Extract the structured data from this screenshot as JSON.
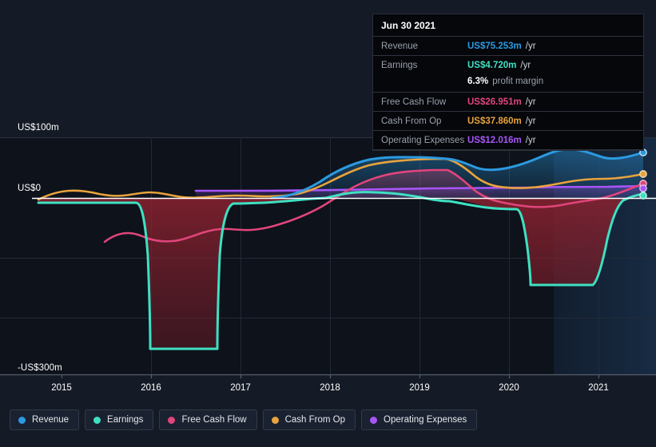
{
  "axes": {
    "y_labels": [
      {
        "text": "US$100m",
        "value": 100
      },
      {
        "text": "US$0",
        "value": 0
      },
      {
        "text": "-US$300m",
        "value": -300
      }
    ],
    "x_labels": [
      "2015",
      "2016",
      "2017",
      "2018",
      "2019",
      "2020",
      "2021"
    ]
  },
  "tooltip": {
    "date": "Jun 30 2021",
    "rows": [
      {
        "label": "Revenue",
        "value": "US$75.253m",
        "unit": "/yr",
        "color": "#2c9ae0"
      },
      {
        "label": "Earnings",
        "value": "US$4.720m",
        "unit": "/yr",
        "color": "#3fe0c2"
      },
      {
        "label": "",
        "value": "6.3%",
        "unit": "profit margin",
        "color": "#ffffff",
        "margin_row": true
      },
      {
        "label": "Free Cash Flow",
        "value": "US$26.951m",
        "unit": "/yr",
        "color": "#e0457b"
      },
      {
        "label": "Cash From Op",
        "value": "US$37.860m",
        "unit": "/yr",
        "color": "#e8a33d"
      },
      {
        "label": "Operating Expenses",
        "value": "US$12.016m",
        "unit": "/yr",
        "color": "#a855f7"
      }
    ]
  },
  "legend": {
    "items": [
      {
        "label": "Revenue",
        "color": "#2c9ae0"
      },
      {
        "label": "Earnings",
        "color": "#3fe0c2"
      },
      {
        "label": "Free Cash Flow",
        "color": "#e0457b"
      },
      {
        "label": "Cash From Op",
        "color": "#e8a33d"
      },
      {
        "label": "Operating Expenses",
        "color": "#a855f7"
      }
    ]
  },
  "chart_data": {
    "type": "area",
    "title": "",
    "xlabel": "",
    "ylabel": "US$",
    "ylim": [
      -300,
      100
    ],
    "xlim": [
      2014.75,
      2021.85
    ],
    "grid": true,
    "legend_position": "bottom-left",
    "annotations": [
      {
        "type": "forecast-region",
        "from_x": 2021.0,
        "label": ""
      }
    ],
    "x": [
      2014.75,
      2015.0,
      2015.25,
      2015.5,
      2015.75,
      2016.0,
      2016.1,
      2016.25,
      2016.5,
      2016.7,
      2016.8,
      2017.0,
      2017.25,
      2017.5,
      2017.75,
      2018.0,
      2018.25,
      2018.5,
      2018.75,
      2019.0,
      2019.25,
      2019.5,
      2019.75,
      2020.0,
      2020.25,
      2020.5,
      2020.75,
      2021.0,
      2021.25,
      2021.5,
      2021.75
    ],
    "series": [
      {
        "name": "Revenue",
        "color": "#2c9ae0",
        "values": [
          null,
          null,
          null,
          null,
          null,
          null,
          null,
          null,
          null,
          null,
          null,
          null,
          null,
          null,
          2,
          14,
          42,
          66,
          78,
          81,
          80,
          66,
          62,
          66,
          78,
          84,
          80,
          72,
          68,
          70,
          75.253
        ]
      },
      {
        "name": "Earnings",
        "color": "#3fe0c2",
        "values": [
          -8,
          -8,
          -8,
          -8,
          -8,
          -10,
          -120,
          -280,
          -280,
          -280,
          -278,
          -16,
          -14,
          -12,
          -10,
          -6,
          2,
          6,
          4,
          -4,
          -22,
          -26,
          -26,
          -24,
          -140,
          -148,
          -150,
          -146,
          -60,
          -8,
          4.72
        ]
      },
      {
        "name": "Free Cash Flow",
        "color": "#e0457b",
        "values": [
          null,
          null,
          -82,
          -76,
          -72,
          -74,
          -72,
          -68,
          -62,
          -60,
          -58,
          -52,
          -46,
          -40,
          -32,
          -22,
          -4,
          24,
          34,
          36,
          8,
          -6,
          -10,
          -14,
          -16,
          -12,
          -10,
          -12,
          -4,
          12,
          26.951
        ]
      },
      {
        "name": "Cash From Op",
        "color": "#e8a33d",
        "values": [
          -2,
          4,
          7,
          6,
          4,
          5,
          4,
          3,
          2,
          2,
          1,
          0,
          -1,
          0,
          2,
          8,
          24,
          44,
          52,
          54,
          22,
          10,
          8,
          6,
          10,
          12,
          10,
          8,
          12,
          24,
          37.86
        ]
      },
      {
        "name": "Operating Expenses",
        "color": "#a855f7",
        "values": [
          null,
          null,
          null,
          null,
          null,
          null,
          null,
          null,
          null,
          8,
          8,
          8,
          8,
          8,
          8,
          8,
          8,
          8,
          9,
          9,
          10,
          10,
          10,
          10,
          11,
          11,
          11,
          11,
          11,
          11.5,
          12.016
        ]
      }
    ]
  }
}
